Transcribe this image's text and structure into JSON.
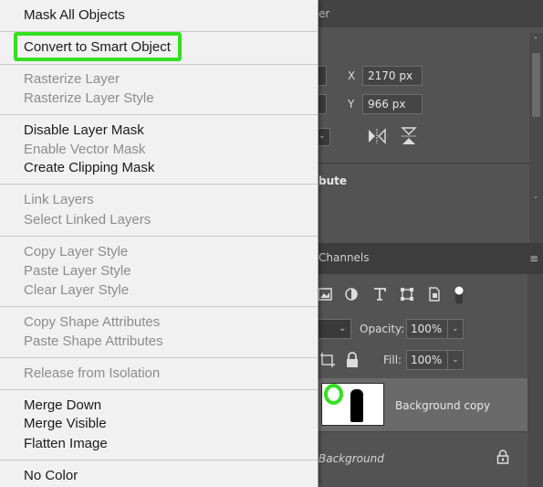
{
  "background": {
    "top_tab_fragment": "er",
    "properties": {
      "x_label": "X",
      "x_value": "2170 px",
      "y_label": "Y",
      "y_value": "966 px",
      "section_fragment": "bute"
    },
    "layers": {
      "channels_tab": "Channels",
      "opacity_label": "Opacity:",
      "opacity_value": "100%",
      "fill_label": "Fill:",
      "fill_value": "100%",
      "selected_layer_name": "Background copy",
      "background_layer_name": "Background"
    }
  },
  "context_menu": {
    "groups": [
      [
        {
          "label": "Mask All Objects",
          "enabled": true
        }
      ],
      [
        {
          "label": "Convert to Smart Object",
          "enabled": true,
          "highlighted": true
        }
      ],
      [
        {
          "label": "Rasterize Layer",
          "enabled": false
        },
        {
          "label": "Rasterize Layer Style",
          "enabled": false
        }
      ],
      [
        {
          "label": "Disable Layer Mask",
          "enabled": true
        },
        {
          "label": "Enable Vector Mask",
          "enabled": false
        },
        {
          "label": "Create Clipping Mask",
          "enabled": true
        }
      ],
      [
        {
          "label": "Link Layers",
          "enabled": false
        },
        {
          "label": "Select Linked Layers",
          "enabled": false
        }
      ],
      [
        {
          "label": "Copy Layer Style",
          "enabled": false
        },
        {
          "label": "Paste Layer Style",
          "enabled": false
        },
        {
          "label": "Clear Layer Style",
          "enabled": false
        }
      ],
      [
        {
          "label": "Copy Shape Attributes",
          "enabled": false
        },
        {
          "label": "Paste Shape Attributes",
          "enabled": false
        }
      ],
      [
        {
          "label": "Release from Isolation",
          "enabled": false
        }
      ],
      [
        {
          "label": "Merge Down",
          "enabled": true
        },
        {
          "label": "Merge Visible",
          "enabled": true
        },
        {
          "label": "Flatten Image",
          "enabled": true
        }
      ],
      [
        {
          "label": "No Color",
          "enabled": true
        }
      ]
    ]
  },
  "colors": {
    "highlight": "#33e020",
    "menu_bg": "#f1f1f1",
    "panel_bg": "#535353"
  }
}
